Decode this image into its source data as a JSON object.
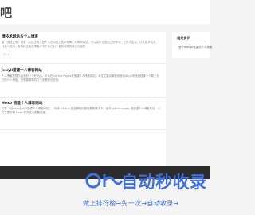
{
  "site": {
    "logo": "吧"
  },
  "posts": [
    {
      "title": "博技术网站与个人博客",
      "excerpt": "客（博技文等）博客（以技文等）是个人在网络上发布文章、文章的网站。可以用来记录自己的学习、工作与生活，分享技术知识，与他人交流。有的博主会在博客中写下自己对于某些事情的看法与感受。",
      "meta": "· 05-11"
    },
    {
      "title": "Jekyll搭建个人博客网站",
      "excerpt": "个人博客是展示自我的一个好地方，可以在GitHub Pages来搭建个人博客网站，本文主要讲解如何使用Jekyll来快速搭建一个属于自己的个人博客，只需要简单的几个步骤即可完成。",
      "meta": ""
    },
    {
      "title": "Hexo 搭建个人博客网站",
      "excerpt": "文章（如Hexo/Jekyll搭建个人博客网站），利用 GitHub 在无需租用服务器的情况下，使用 github pages 来搭建个人博客网站。本文主要讲解 Hexo 的安装与配置过程。",
      "meta": ""
    }
  ],
  "sidebar": {
    "title": "相关资讯",
    "link": "· 基于django框架的个人博客"
  },
  "watermark": {
    "title": "自动秒收录",
    "subtitle": "做上排行榜→先一次→自动收录→"
  }
}
